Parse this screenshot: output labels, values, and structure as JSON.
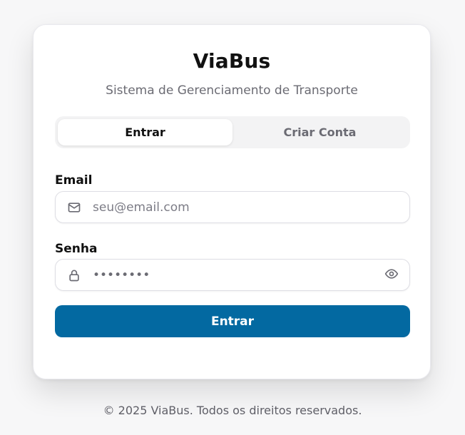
{
  "app": {
    "title": "ViaBus",
    "subtitle": "Sistema de Gerenciamento de Transporte"
  },
  "tabs": [
    {
      "label": "Entrar",
      "active": true
    },
    {
      "label": "Criar Conta",
      "active": false
    }
  ],
  "form": {
    "email": {
      "label": "Email",
      "placeholder": "seu@email.com",
      "value": ""
    },
    "password": {
      "label": "Senha",
      "value": "••••••••"
    },
    "submit_label": "Entrar"
  },
  "footer": {
    "text": "© 2025 ViaBus. Todos os direitos reservados."
  },
  "icons": {
    "email": "mail-icon",
    "password": "lock-icon",
    "show_password": "eye-icon"
  },
  "colors": {
    "primary": "#0369a1",
    "card_bg": "#ffffff",
    "page_bg": "#f7f7f8",
    "tabs_bg": "#f3f3f4",
    "muted_text": "#6b6b73"
  }
}
